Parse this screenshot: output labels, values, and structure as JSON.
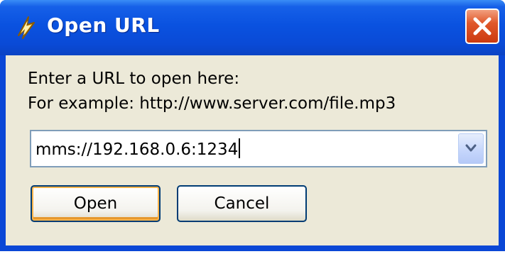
{
  "dialog": {
    "title": "Open URL",
    "close_icon": "close-x-icon",
    "app_icon": "lightning-bolt-icon"
  },
  "prompt": {
    "line1": "Enter a URL to open here:",
    "line2": "For example: http://www.server.com/file.mp3"
  },
  "url_field": {
    "value": "mms://192.168.0.6:1234",
    "dropdown_icon": "chevron-down-icon"
  },
  "buttons": {
    "open_label": "Open",
    "cancel_label": "Cancel"
  },
  "colors": {
    "titlebar": "#0a52e0",
    "client_background": "#ece9d8",
    "close_button": "#e0582b",
    "default_button_highlight": "#f9b44b"
  }
}
